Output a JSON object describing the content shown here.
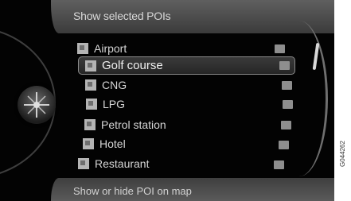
{
  "header": {
    "title": "Show selected POIs"
  },
  "items": [
    {
      "label": "Airport",
      "selected": false
    },
    {
      "label": "Golf course",
      "selected": true
    },
    {
      "label": "CNG",
      "selected": false
    },
    {
      "label": "LPG",
      "selected": false
    },
    {
      "label": "Petrol station",
      "selected": false
    },
    {
      "label": "Hotel",
      "selected": false
    },
    {
      "label": "Restaurant",
      "selected": false
    }
  ],
  "footer": {
    "hint": "Show or hide POI on map"
  },
  "figure_code": "G044262",
  "colors": {
    "background": "#030303",
    "text": "#d6d6d6",
    "bar": "#4a4a4a"
  }
}
